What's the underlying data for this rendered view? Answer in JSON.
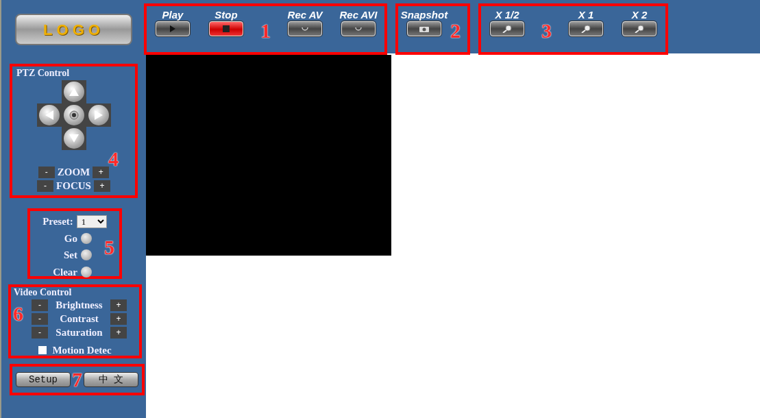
{
  "logo": {
    "text": "LOGO"
  },
  "toolbar": {
    "groups": [
      {
        "annotation": "1",
        "buttons": [
          {
            "label": "Play",
            "kind": "play"
          },
          {
            "label": "Stop",
            "kind": "stop"
          },
          {
            "label": "Rec AV",
            "kind": "record"
          },
          {
            "label": "Rec AVI",
            "kind": "record"
          }
        ]
      },
      {
        "annotation": "2",
        "buttons": [
          {
            "label": "Snapshot",
            "kind": "camera"
          }
        ]
      },
      {
        "annotation": "3",
        "buttons": [
          {
            "label": "X 1/2",
            "kind": "zoom"
          },
          {
            "label": "X 1",
            "kind": "zoom"
          },
          {
            "label": "X 2",
            "kind": "zoom"
          }
        ]
      }
    ]
  },
  "ptz": {
    "annotation": "4",
    "title": "PTZ Control",
    "adjusters": [
      {
        "label": "ZOOM",
        "minus": "-",
        "plus": "+"
      },
      {
        "label": "FOCUS",
        "minus": "-",
        "plus": "+"
      }
    ]
  },
  "preset": {
    "annotation": "5",
    "label": "Preset:",
    "value": "1",
    "actions": [
      "Go",
      "Set",
      "Clear"
    ]
  },
  "video_control": {
    "annotation": "6",
    "title": "Video Control",
    "adjusters": [
      {
        "label": "Brightness",
        "minus": "-",
        "plus": "+"
      },
      {
        "label": "Contrast",
        "minus": "-",
        "plus": "+"
      },
      {
        "label": "Saturation",
        "minus": "-",
        "plus": "+"
      }
    ],
    "motion_detect": {
      "label": "Motion Detec",
      "checked": false
    }
  },
  "footer": {
    "annotation": "7",
    "buttons": [
      "Setup",
      "中 文"
    ]
  }
}
